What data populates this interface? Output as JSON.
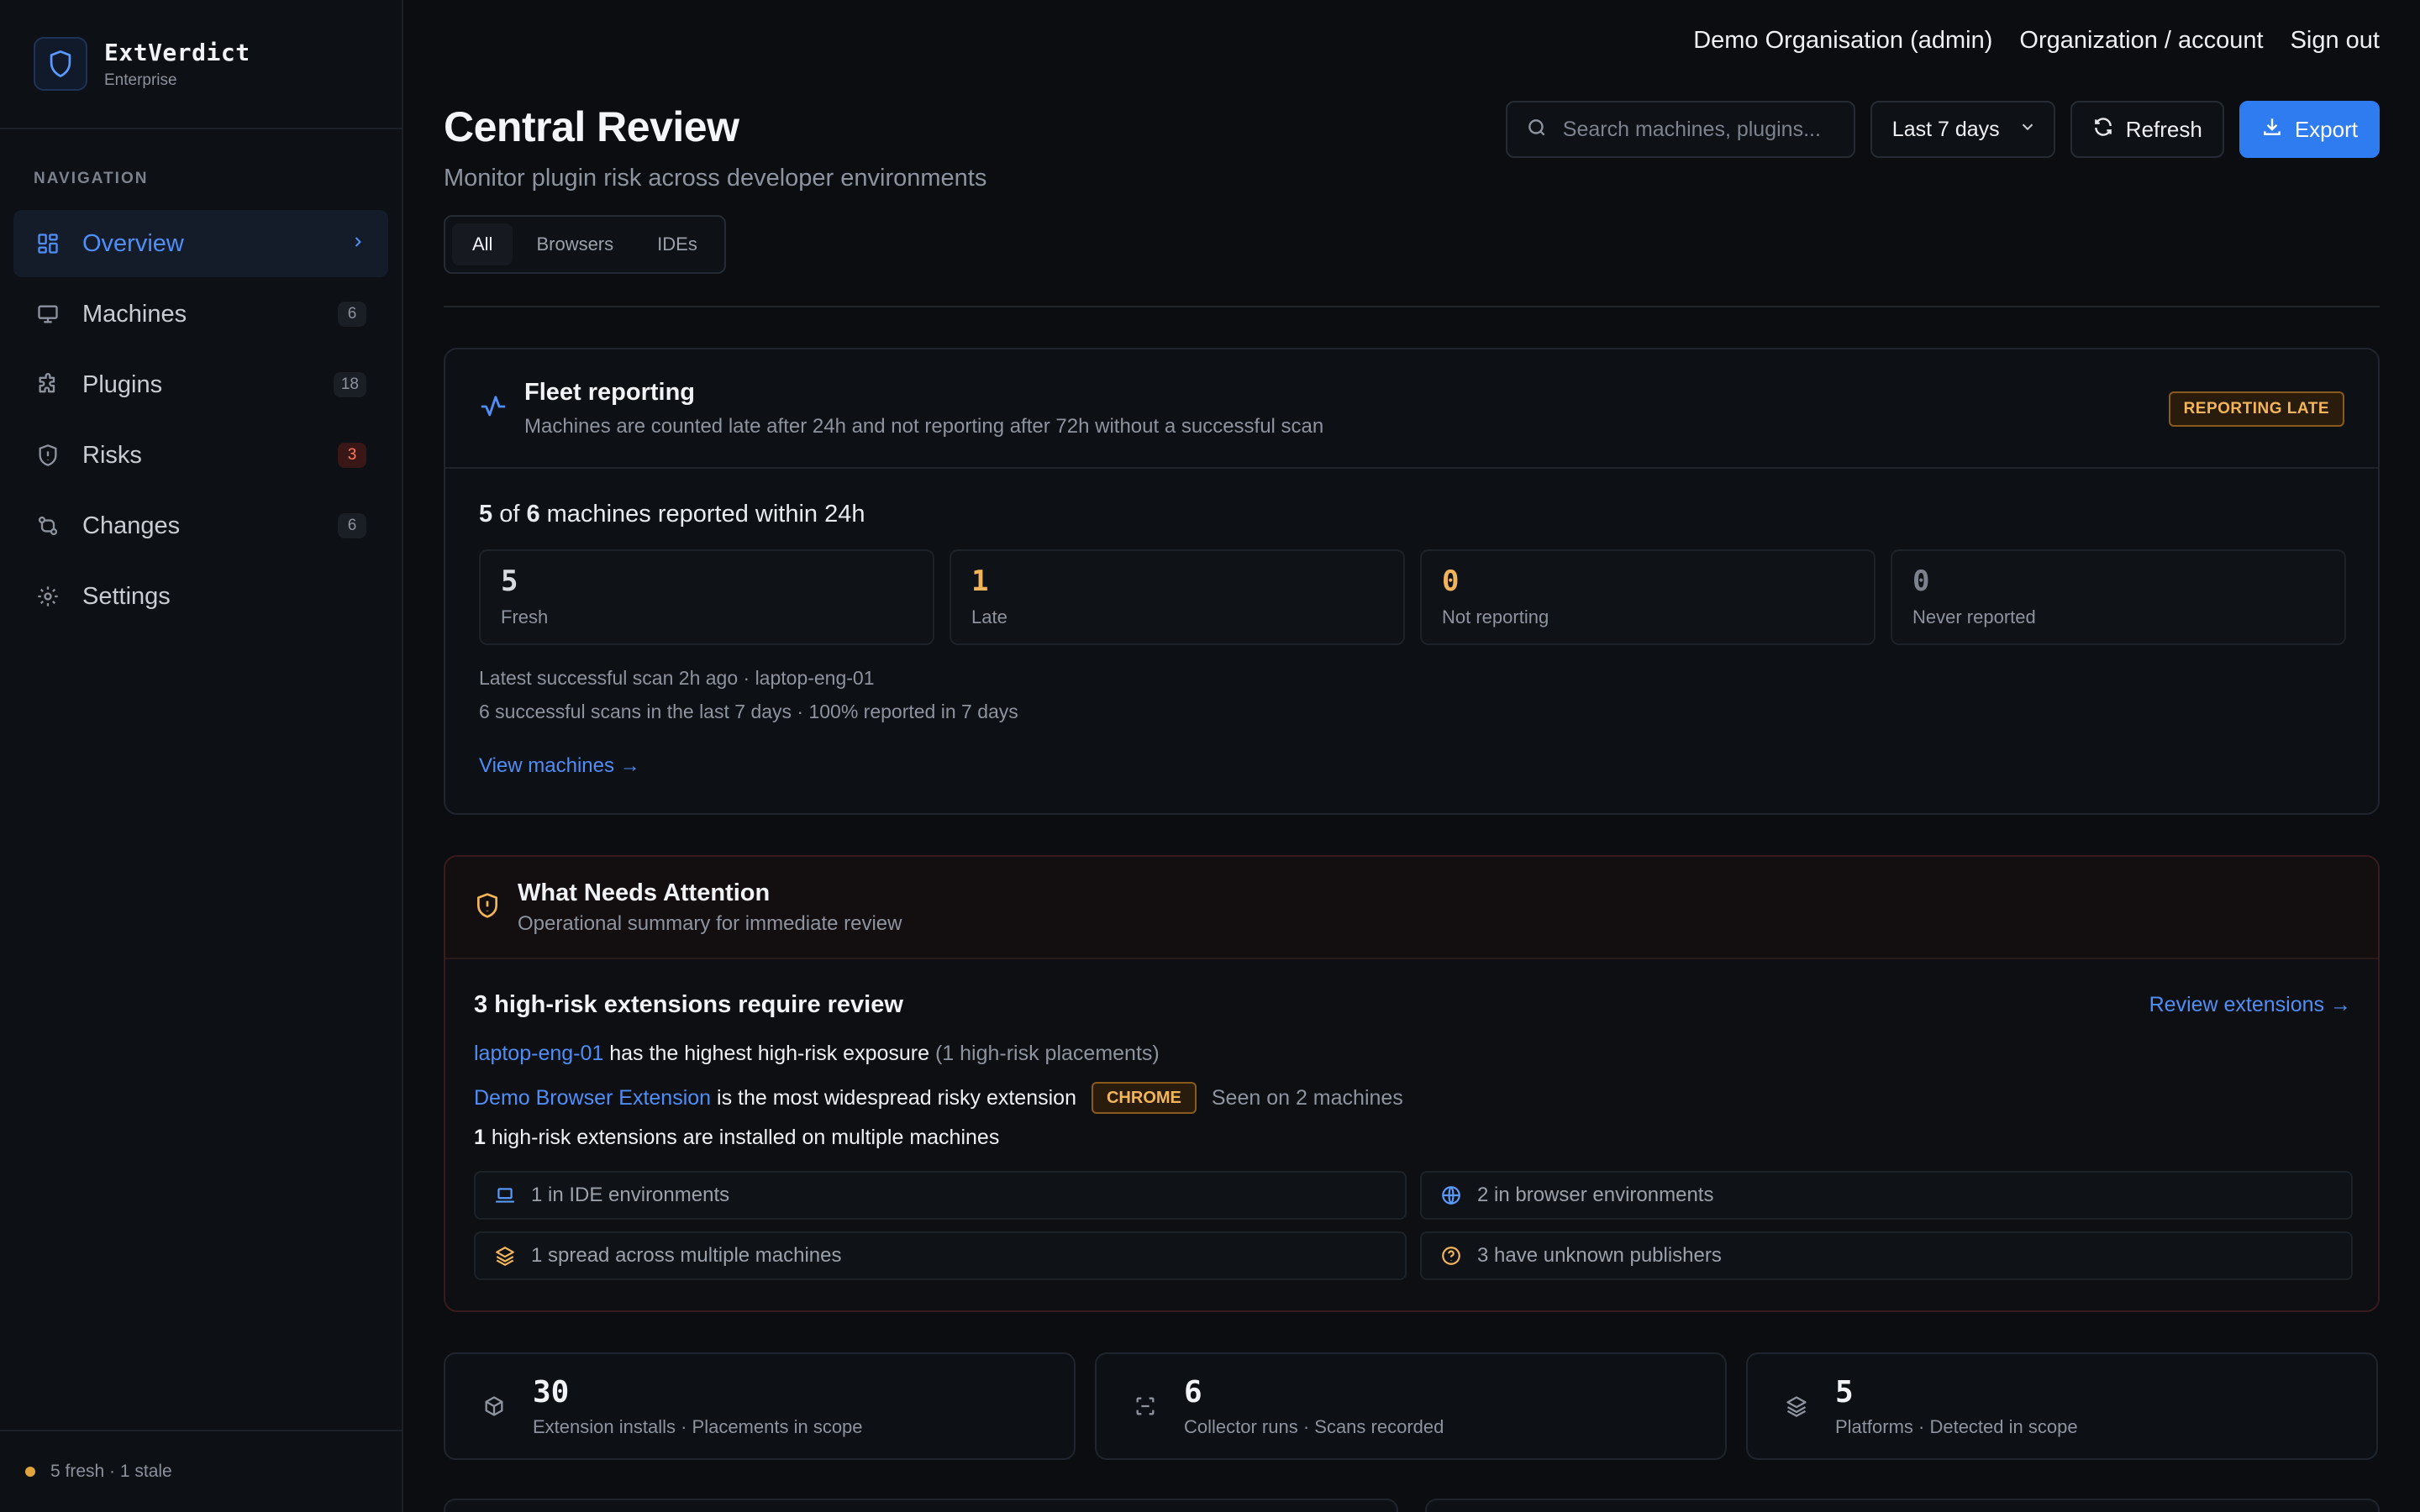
{
  "brand": {
    "name": "ExtVerdict",
    "tier": "Enterprise"
  },
  "nav": {
    "heading": "NAVIGATION",
    "items": [
      {
        "label": "Overview",
        "icon": "grid-icon",
        "badge": ""
      },
      {
        "label": "Machines",
        "icon": "monitor-icon",
        "badge": "6"
      },
      {
        "label": "Plugins",
        "icon": "puzzle-icon",
        "badge": "18"
      },
      {
        "label": "Risks",
        "icon": "shield-alert-icon",
        "badge": "3"
      },
      {
        "label": "Changes",
        "icon": "git-compare-icon",
        "badge": "6"
      },
      {
        "label": "Settings",
        "icon": "gear-icon",
        "badge": ""
      }
    ],
    "footer_status": "5 fresh · 1 stale"
  },
  "topbar": {
    "org": "Demo Organisation (admin)",
    "account": "Organization / account",
    "signout": "Sign out"
  },
  "header": {
    "title": "Central Review",
    "subtitle": "Monitor plugin risk across developer environments",
    "search_placeholder": "Search machines, plugins...",
    "range": "Last 7 days",
    "refresh": "Refresh",
    "export": "Export",
    "tabs": [
      "All",
      "Browsers",
      "IDEs"
    ]
  },
  "fleet": {
    "title": "Fleet reporting",
    "desc": "Machines are counted late after 24h and not reporting after 72h without a successful scan",
    "badge": "REPORTING LATE",
    "summary_reported": "5",
    "summary_of": " of ",
    "summary_total": "6",
    "summary_suffix": " machines reported within 24h",
    "stats": [
      {
        "value": "5",
        "label": "Fresh"
      },
      {
        "value": "1",
        "label": "Late"
      },
      {
        "value": "0",
        "label": "Not reporting"
      },
      {
        "value": "0",
        "label": "Never reported"
      }
    ],
    "latest_scan": "Latest successful scan 2h ago · laptop-eng-01",
    "scans_summary": "6 successful scans in the last 7 days · 100% reported in 7 days",
    "view_link": "View machines →"
  },
  "attention": {
    "title": "What Needs Attention",
    "desc": "Operational summary for immediate review",
    "headline": "3 high-risk extensions require review",
    "review_link": "Review extensions →",
    "exposure_machine": "laptop-eng-01",
    "exposure_text": " has the highest high-risk exposure ",
    "exposure_note": "(1 high-risk placements)",
    "widespread_ext": "Demo Browser Extension",
    "widespread_text": " is the most widespread risky extension",
    "widespread_tag": "CHROME",
    "widespread_seen": "Seen on 2 machines",
    "multi_count": "1",
    "multi_text": " high-risk extensions are installed on multiple machines",
    "cells": [
      {
        "icon": "laptop-icon",
        "text": "1 in IDE environments"
      },
      {
        "icon": "globe-icon",
        "text": "2 in browser environments"
      },
      {
        "icon": "layers-icon",
        "text": "1 spread across multiple machines"
      },
      {
        "icon": "help-circle-icon",
        "text": "3 have unknown publishers"
      }
    ]
  },
  "metrics": [
    {
      "value": "30",
      "label": "Extension installs · Placements in scope",
      "icon": "box-icon"
    },
    {
      "value": "6",
      "label": "Collector runs · Scans recorded",
      "icon": "scan-icon"
    },
    {
      "value": "5",
      "label": "Platforms · Detected in scope",
      "icon": "layers-icon"
    }
  ],
  "colors": {
    "accent": "#2f7cf0",
    "warning": "#f3b559",
    "danger": "#ff7a5c"
  }
}
